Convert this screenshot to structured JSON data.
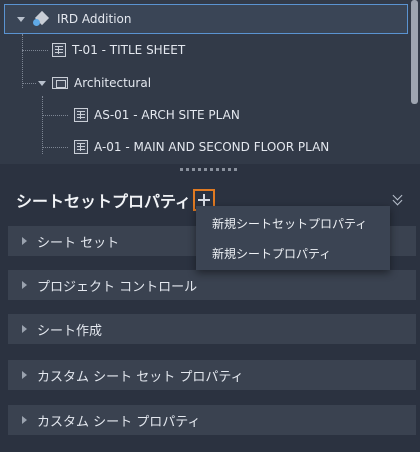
{
  "tree": {
    "root": "IRD Addition",
    "items": [
      {
        "label": "T-01 - TITLE SHEET"
      },
      {
        "label": "Architectural"
      },
      {
        "label": "AS-01 - ARCH SITE PLAN"
      },
      {
        "label": "A-01 - MAIN AND SECOND FLOOR PLAN"
      }
    ]
  },
  "properties": {
    "title": "シートセットプロパティ",
    "sections": [
      "シート セット",
      "プロジェクト コントロール",
      "シート作成",
      "カスタム シート セット プロパティ",
      "カスタム シート プロパティ"
    ]
  },
  "menu": {
    "items": [
      "新規シートセットプロパティ",
      "新規シートプロパティ"
    ]
  },
  "colors": {
    "accent_outline": "#e07a22",
    "selection_border": "#5a93d1"
  }
}
